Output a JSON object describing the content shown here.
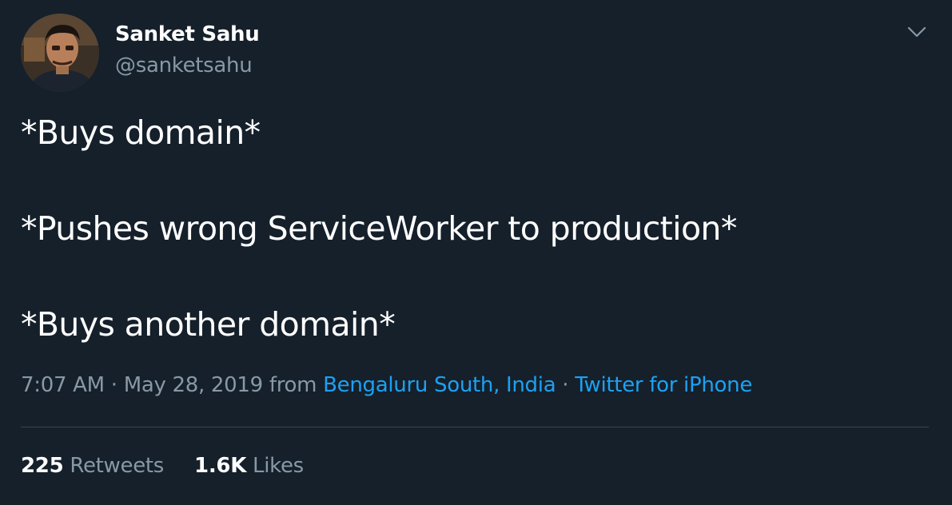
{
  "author": {
    "name": "Sanket Sahu",
    "handle": "@sanketsahu"
  },
  "tweet": {
    "lines": [
      "*Buys domain*",
      "*Pushes wrong ServiceWorker to production*",
      "*Buys another domain*"
    ]
  },
  "meta": {
    "time": "7:07 AM",
    "separator": " · ",
    "date": "May 28, 2019",
    "from_word": " from ",
    "location": "Bengaluru South, India",
    "source": "Twitter for iPhone"
  },
  "stats": {
    "retweets_count": "225",
    "retweets_label": "Retweets",
    "likes_count": "1.6K",
    "likes_label": "Likes"
  },
  "icons": {
    "menu": "chevron-down-icon",
    "avatar": "profile-photo"
  },
  "colors": {
    "background": "#15202b",
    "text": "#ffffff",
    "secondary_text": "#8899a6",
    "link": "#1da1f2",
    "divider": "#38444d"
  }
}
